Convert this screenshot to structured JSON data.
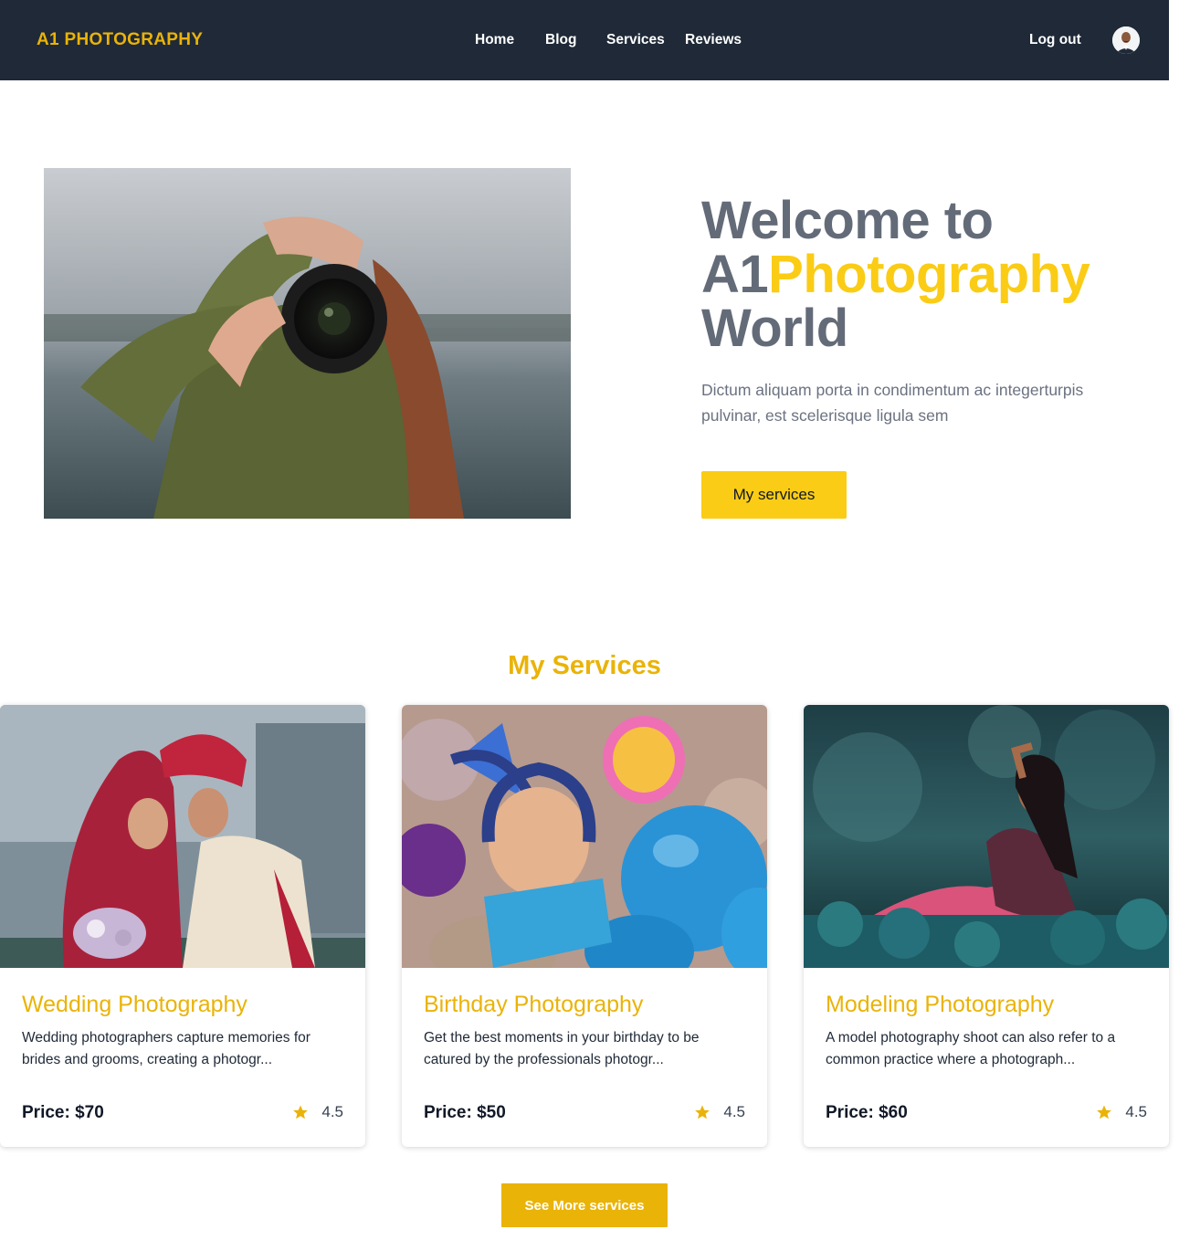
{
  "nav": {
    "brand": "A1 PHOTOGRAPHY",
    "links": [
      "Home",
      "Blog",
      "Services",
      "Reviews"
    ],
    "logout": "Log out"
  },
  "hero": {
    "title_prefix": "Welcome to A1",
    "title_accent": "Photography",
    "title_suffix": "World",
    "description": "Dictum aliquam porta in condimentum ac integerturpis pulvinar, est scelerisque ligula sem",
    "button": "My services"
  },
  "services": {
    "title": "My Services",
    "cards": [
      {
        "title": "Wedding Photography",
        "description": "Wedding photographers capture memories for brides and grooms, creating a photogr...",
        "price": "Price: $70",
        "rating": "4.5"
      },
      {
        "title": "Birthday Photography",
        "description": "Get the best moments in your birthday to be catured by the professionals photogr...",
        "price": "Price: $50",
        "rating": "4.5"
      },
      {
        "title": "Modeling Photography",
        "description": "A model photography shoot can also refer to a common practice where a photograph...",
        "price": "Price: $60",
        "rating": "4.5"
      }
    ],
    "more_button": "See More services"
  },
  "colors": {
    "nav_bg": "#1f2937",
    "accent": "#eab308",
    "accent_light": "#facc15",
    "hero_text": "#646b78"
  },
  "icons": {
    "rating": "star-icon",
    "avatar": "user-avatar"
  }
}
